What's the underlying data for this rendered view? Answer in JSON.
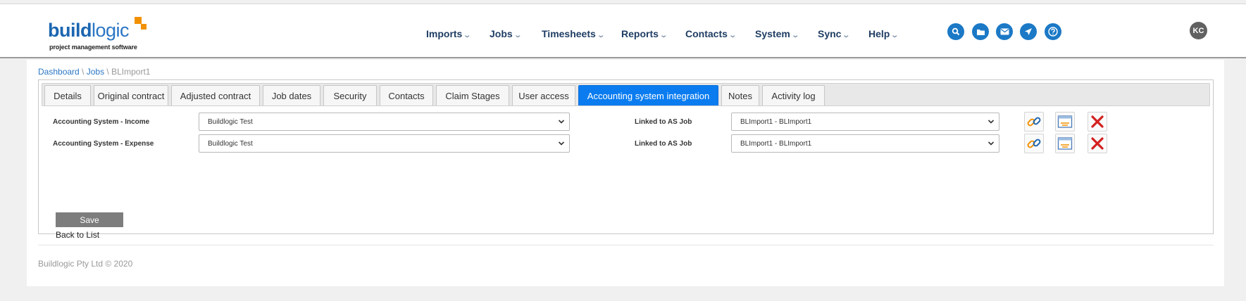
{
  "brand": {
    "name_bold": "build",
    "name_light": "logic",
    "tagline": "project management software"
  },
  "nav": {
    "items": [
      {
        "label": "Imports"
      },
      {
        "label": "Jobs"
      },
      {
        "label": "Timesheets"
      },
      {
        "label": "Reports"
      },
      {
        "label": "Contacts"
      },
      {
        "label": "System"
      },
      {
        "label": "Sync"
      },
      {
        "label": "Help"
      }
    ],
    "chevron": "⌄"
  },
  "header_icons": [
    "search-icon",
    "folder-icon",
    "mail-icon",
    "send-icon",
    "help-icon"
  ],
  "user": {
    "initials": "KC"
  },
  "breadcrumb": {
    "items": [
      "Dashboard",
      "Jobs",
      "BLImport1"
    ],
    "separator": " \\ "
  },
  "tabs": [
    {
      "label": "Details"
    },
    {
      "label": "Original contract"
    },
    {
      "label": "Adjusted contract"
    },
    {
      "label": "Job dates"
    },
    {
      "label": "Security"
    },
    {
      "label": "Contacts"
    },
    {
      "label": "Claim Stages"
    },
    {
      "label": "User access"
    },
    {
      "label": "Accounting system integration",
      "active": true
    },
    {
      "label": "Notes"
    },
    {
      "label": "Activity log"
    }
  ],
  "form": {
    "rows": [
      {
        "label": "Accounting System - Income",
        "system_value": "Buildlogic Test",
        "job_label": "Linked to AS Job",
        "job_value": "BLImport1 - BLImport1"
      },
      {
        "label": "Accounting System - Expense",
        "system_value": "Buildlogic Test",
        "job_label": "Linked to AS Job",
        "job_value": "BLImport1 - BLImport1"
      }
    ],
    "save_label": "Save",
    "back_label": "Back to List"
  },
  "footer": {
    "text": "Buildlogic Pty Ltd © 2020"
  },
  "colors": {
    "accent": "#0a7cf0",
    "nav_text": "#1f3d63",
    "brand_blue": "#1b66b0",
    "brand_orange": "#f29100",
    "icon_blue": "#1b79c6",
    "delete_red": "#d42020"
  }
}
